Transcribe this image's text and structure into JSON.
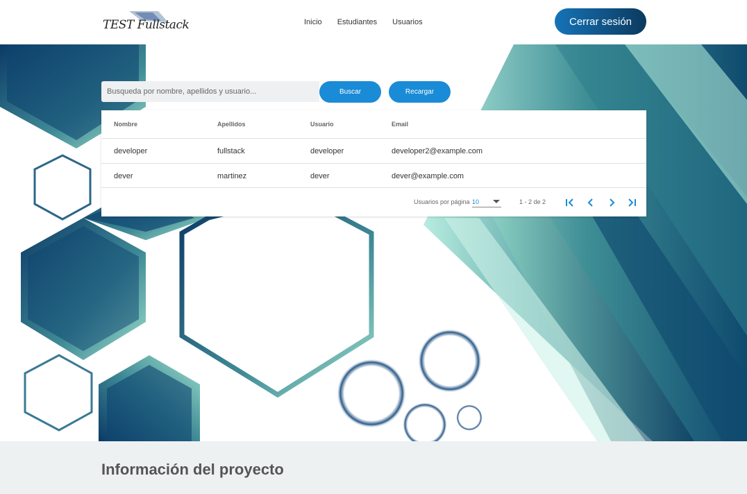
{
  "header": {
    "logo_text": "TEST Fullstack",
    "nav": [
      "Inicio",
      "Estudiantes",
      "Usuarios"
    ],
    "logout_label": "Cerrar sesión"
  },
  "search": {
    "placeholder": "Busqueda por nombre, apellidos y usuario...",
    "search_label": "Buscar",
    "reload_label": "Recargar"
  },
  "table": {
    "columns": [
      "Nombre",
      "Apellidos",
      "Usuario",
      "Email"
    ],
    "rows": [
      [
        "developer",
        "fullstack",
        "developer",
        "developer2@example.com"
      ],
      [
        "dever",
        "martinez",
        "dever",
        "dever@example.com"
      ]
    ]
  },
  "paginator": {
    "per_page_label": "Usuarios por página",
    "per_page_value": "10",
    "range_label": "1 - 2 de 2"
  },
  "footer": {
    "title": "Información del proyecto"
  },
  "colors": {
    "accent": "#1a8bd6",
    "dark_teal": "#0c3a5e",
    "mint": "#8fd9c6"
  },
  "icons": [
    "first-page-icon",
    "prev-page-icon",
    "next-page-icon",
    "last-page-icon",
    "dropdown-arrow-icon"
  ]
}
